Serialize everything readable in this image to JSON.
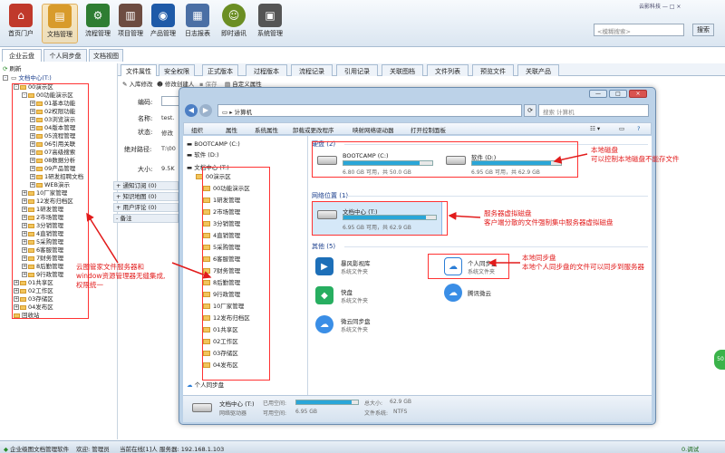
{
  "toolbar": {
    "items": [
      {
        "label": "首页门户",
        "icon": "home-icon",
        "color": "#c0392b"
      },
      {
        "label": "文档管理",
        "icon": "document-box-icon",
        "color": "#d89b2b"
      },
      {
        "label": "流程管理",
        "icon": "flow-icon",
        "color": "#2e7d32"
      },
      {
        "label": "项目管理",
        "icon": "books-icon",
        "color": "#6d4c41"
      },
      {
        "label": "产品管理",
        "icon": "satellite-icon",
        "color": "#1e5aa8"
      },
      {
        "label": "日志报表",
        "icon": "calendar-icon",
        "color": "#4a6fa5"
      },
      {
        "label": "即时通讯",
        "icon": "chat-icon",
        "color": "#6b8e23"
      },
      {
        "label": "系统管理",
        "icon": "server-icon",
        "color": "#555555"
      }
    ],
    "search_placeholder": "<模糊搜索>",
    "search_button": "搜索",
    "window_controls": "云影科技 — □ ×"
  },
  "left_tabs": [
    "企业云盘",
    "个人同步盘",
    "文档视图"
  ],
  "tree": {
    "refresh": "刷新",
    "root": "文档中心(T:)",
    "rows": [
      {
        "label": "00演示区",
        "level": 1,
        "pm": "-"
      },
      {
        "label": "00功能演示区",
        "level": 2,
        "pm": "-"
      },
      {
        "label": "01基本功能",
        "level": 3,
        "pm": "+"
      },
      {
        "label": "02权限功能",
        "level": 3,
        "pm": "+"
      },
      {
        "label": "03浏览演示",
        "level": 3,
        "pm": "+"
      },
      {
        "label": "04版本管理",
        "level": 3,
        "pm": "+"
      },
      {
        "label": "05流程管理",
        "level": 3,
        "pm": "+"
      },
      {
        "label": "06引用关联",
        "level": 3,
        "pm": "+"
      },
      {
        "label": "07高级搜索",
        "level": 3,
        "pm": "+"
      },
      {
        "label": "08数据分析",
        "level": 3,
        "pm": "+"
      },
      {
        "label": "09产品管理",
        "level": 3,
        "pm": "+"
      },
      {
        "label": "1研发招聘文档",
        "level": 3,
        "pm": "+"
      },
      {
        "label": "WEB演示",
        "level": 3,
        "pm": "+"
      },
      {
        "label": "10厂家管理",
        "level": 2,
        "pm": "+"
      },
      {
        "label": "12发布归档区",
        "level": 2,
        "pm": "+"
      },
      {
        "label": "1研发管理",
        "level": 2,
        "pm": "+"
      },
      {
        "label": "2市场管理",
        "level": 2,
        "pm": "+"
      },
      {
        "label": "3分销管理",
        "level": 2,
        "pm": "+"
      },
      {
        "label": "4直销管理",
        "level": 2,
        "pm": "+"
      },
      {
        "label": "5采购管理",
        "level": 2,
        "pm": "+"
      },
      {
        "label": "6客服管理",
        "level": 2,
        "pm": "+"
      },
      {
        "label": "7财务管理",
        "level": 2,
        "pm": "+"
      },
      {
        "label": "8后勤管理",
        "level": 2,
        "pm": "+"
      },
      {
        "label": "9行政管理",
        "level": 2,
        "pm": "+"
      },
      {
        "label": "01共享区",
        "level": 1,
        "pm": "+"
      },
      {
        "label": "02工作区",
        "level": 1,
        "pm": "+"
      },
      {
        "label": "03存储区",
        "level": 1,
        "pm": "+"
      },
      {
        "label": "04发布区",
        "level": 1,
        "pm": "+"
      },
      {
        "label": "回收站",
        "level": 1,
        "pm": ""
      }
    ]
  },
  "doc_tabs": [
    "文件属性",
    "安全权限",
    "正式版本",
    "过程版本",
    "流程记录",
    "引用记录",
    "关联图档",
    "文件列表",
    "预览文件",
    "关联产品"
  ],
  "doc_tools": [
    "入库修改",
    "修改创建人",
    "保存",
    "自定义属性"
  ],
  "fields": {
    "code_label": "编码:",
    "name_label": "名称:",
    "name_value": "test.",
    "status_label": "状态:",
    "status_value": "修改",
    "path_label": "绝对路径:",
    "path_value": "T:\\00",
    "size_label": "大小:",
    "size_value": "9.5K"
  },
  "sections": [
    "通知订阅 (0)",
    "知识地图 (0)",
    "用户评论 (0)",
    "备注"
  ],
  "explorer": {
    "address": "计算机",
    "search_placeholder": "搜索 计算机",
    "menu": [
      "组织",
      "属性",
      "系统属性",
      "卸载或更改程序",
      "映射网络驱动器",
      "打开控制面板"
    ],
    "nav": {
      "drives": [
        "BOOTCAMP (C:)",
        "软件 (D:)",
        "文档中心 (T:)"
      ],
      "folders": [
        "00演示区",
        "00功能演示区",
        "1研发管理",
        "2市场管理",
        "3分销管理",
        "4直销管理",
        "5采购管理",
        "6客服管理",
        "7财务管理",
        "8后勤管理",
        "9行政管理",
        "10厂家管理",
        "12发布归档区",
        "01共享区",
        "02工作区",
        "03存储区",
        "04发布区"
      ],
      "sync": "个人同步盘"
    },
    "disks_header": "硬盘 (2)",
    "disks": [
      {
        "name": "BOOTCAMP (C:)",
        "size": "6.80 GB 可用，共 50.0 GB",
        "fill": 0.86
      },
      {
        "name": "软件 (D:)",
        "size": "6.95 GB 可用，共 62.9 GB",
        "fill": 0.89
      }
    ],
    "net_header": "网络位置 (1)",
    "net": {
      "name": "文档中心 (T:)",
      "size": "6.95 GB 可用，共 62.9 GB",
      "fill": 0.89
    },
    "other_header": "其他 (5)",
    "others": [
      {
        "name": "暴风影视库",
        "sub": "系统文件夹",
        "icon": "storm-video-icon",
        "color": "#1d6fb8"
      },
      {
        "name": "个人同步盘",
        "sub": "系统文件夹",
        "icon": "cloud-icon",
        "color": "#2c7ed6"
      },
      {
        "name": "快盘",
        "sub": "系统文件夹",
        "icon": "kuaipan-icon",
        "color": "#27ae60"
      },
      {
        "name": "腾讯微云",
        "sub": "",
        "icon": "weiyun-icon",
        "color": "#3a8ee6"
      },
      {
        "name": "微云同步盘",
        "sub": "系统文件夹",
        "icon": "weiyun-sync-icon",
        "color": "#3a8ee6"
      }
    ],
    "status": {
      "name": "文档中心 (T:)",
      "type": "网络驱动器",
      "used_label": "已用空间:",
      "free_label": "可用空间:",
      "free": "6.95 GB",
      "total_label": "总大小:",
      "total": "62.9 GB",
      "fs_label": "文件系统:",
      "fs": "NTFS"
    }
  },
  "annotations": {
    "local_disk": [
      "本地磁盘",
      "可以控制本地磁盘不能存文件"
    ],
    "server_disk": [
      "服务器虚拟磁盘",
      "客户端分散的文件强制集中服务器虚拟磁盘"
    ],
    "sync_disk": [
      "本地同步盘",
      "本地个人同步盘的文件可以同步到服务器"
    ],
    "left": [
      "云图管家文件服务器和",
      "window资源管理器无缝集成,",
      "权限统一"
    ]
  },
  "statusbar": {
    "app": "企业级图文档管理软件",
    "welcome": "欢迎: 管理员",
    "online": "当前在线[1]人",
    "server": "服务器: 192.168.1.103",
    "right": "0.调试"
  },
  "side_badge": "50",
  "colors": {
    "accent": "#2aa6d8",
    "annotation": "#e21b1b",
    "group": "#1a3e8c"
  }
}
